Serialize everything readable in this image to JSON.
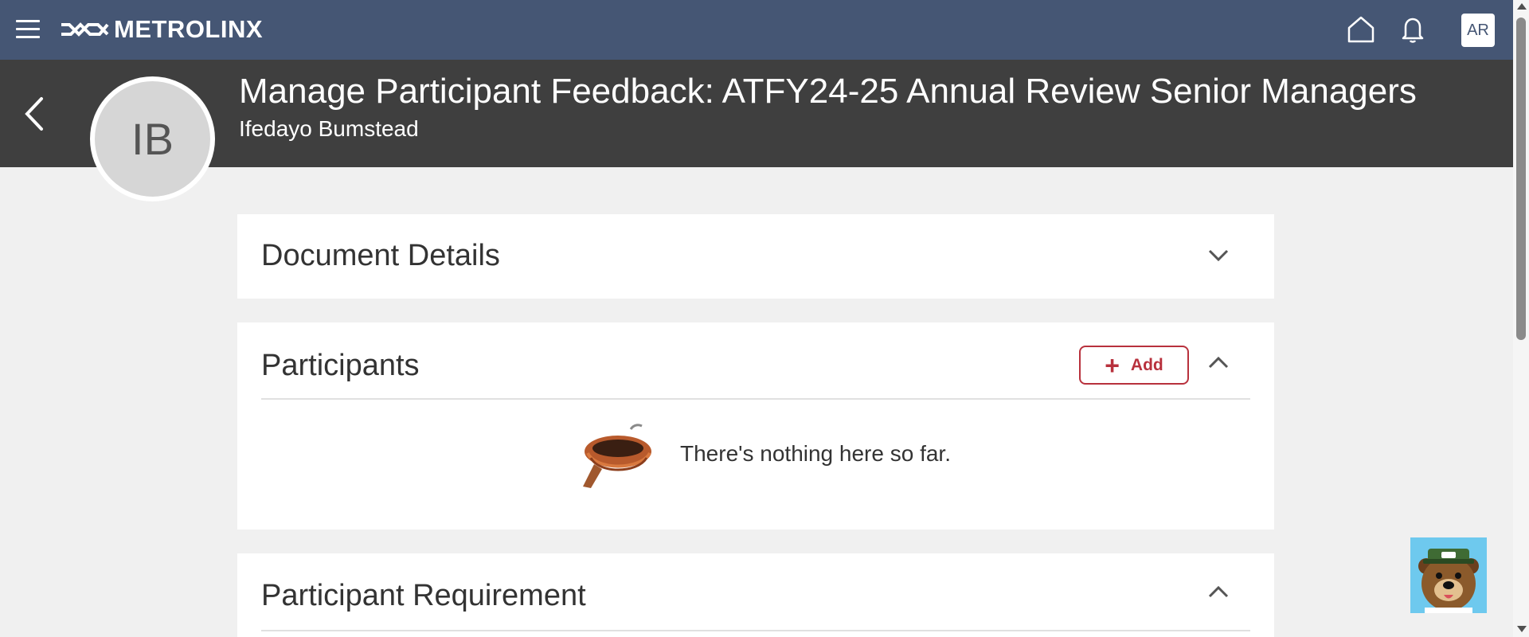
{
  "topbar": {
    "brand": "METROLINX",
    "user_initials": "AR",
    "icons": [
      "menu-icon",
      "home-icon",
      "bell-icon"
    ]
  },
  "header": {
    "title": "Manage Participant Feedback: ATFY24-25 Annual Review Senior Managers",
    "subtitle": "Ifedayo Bumstead",
    "avatar_initials": "IB"
  },
  "sections": {
    "document_details": {
      "title": "Document Details",
      "state": "collapsed"
    },
    "participants": {
      "title": "Participants",
      "add_label": "Add",
      "empty_text": "There's nothing here so far.",
      "state": "expanded"
    },
    "participant_requirement": {
      "title": "Participant Requirement",
      "state": "expanded"
    }
  },
  "colors": {
    "topbar": "#455674",
    "header_band": "#3f3f3f",
    "accent_red": "#b8313d",
    "page_bg": "#f0f0f0"
  }
}
